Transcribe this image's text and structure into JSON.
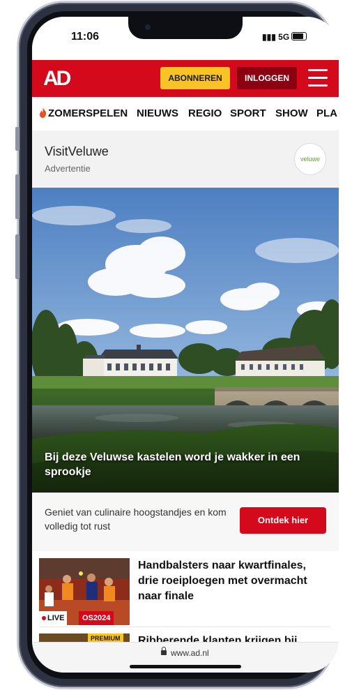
{
  "status_bar": {
    "time": "11:06",
    "network": "5G"
  },
  "header": {
    "logo": "AD",
    "subscribe_label": "ABONNEREN",
    "login_label": "INLOGGEN"
  },
  "nav": {
    "items": [
      "ZOMERSPELEN",
      "NIEUWS",
      "REGIO",
      "SPORT",
      "SHOW",
      "PLA"
    ]
  },
  "ad": {
    "brand": "VisitVeluwe",
    "label": "Advertentie",
    "logo_text": "veluwe"
  },
  "hero": {
    "caption": "Bij deze Veluwse kastelen word je wakker in een sprookje"
  },
  "promo": {
    "text": "Geniet van culinaire hoogstandjes en kom volledig tot rust",
    "button_label": "Ontdek hier"
  },
  "articles": [
    {
      "title": "Handbalsters naar kwartfinales, drie roeiploegen met overmacht naar finale",
      "live_label": "LIVE",
      "tag": "OS2024"
    },
    {
      "title": "Ribberende klanten krijgen bij",
      "badge": "PREMIUM"
    }
  ],
  "url_bar": {
    "url": "www.ad.nl"
  },
  "colors": {
    "brand_red": "#d4091c",
    "accent_yellow": "#f8c327",
    "dark_red": "#8a0211"
  }
}
